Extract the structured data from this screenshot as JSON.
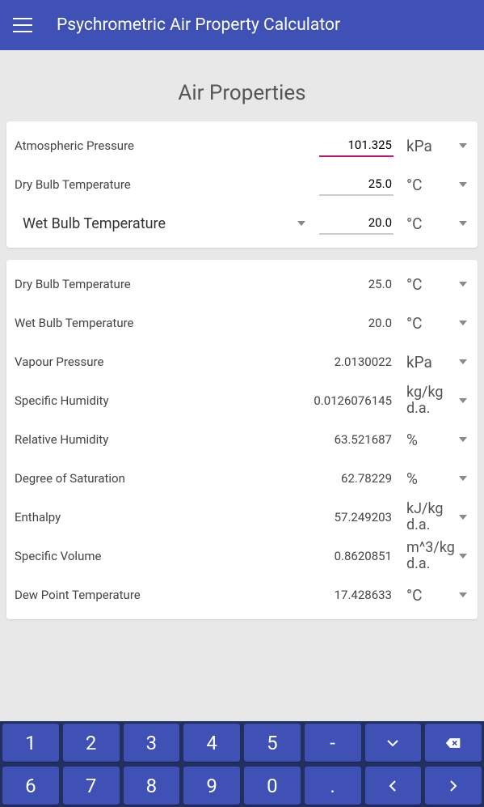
{
  "header": {
    "title": "Psychrometric Air Property Calculator"
  },
  "section_title": "Air Properties",
  "inputs": {
    "pressure": {
      "label": "Atmospheric Pressure",
      "value": "101.325",
      "unit": "kPa"
    },
    "dry_bulb": {
      "label": "Dry Bulb Temperature",
      "value": "25.0",
      "unit": "°C"
    },
    "wet_bulb": {
      "label": "Wet Bulb Temperature",
      "value": "20.0",
      "unit": "°C"
    }
  },
  "results": [
    {
      "label": "Dry Bulb Temperature",
      "value": "25.0",
      "unit": "°C"
    },
    {
      "label": "Wet Bulb Temperature",
      "value": "20.0",
      "unit": "°C"
    },
    {
      "label": "Vapour Pressure",
      "value": "2.0130022",
      "unit": "kPa"
    },
    {
      "label": "Specific Humidity",
      "value": "0.0126076145",
      "unit": "kg/kg d.a."
    },
    {
      "label": "Relative Humidity",
      "value": "63.521687",
      "unit": "%"
    },
    {
      "label": "Degree of Saturation",
      "value": "62.78229",
      "unit": "%"
    },
    {
      "label": "Enthalpy",
      "value": "57.249203",
      "unit": "kJ/kg d.a."
    },
    {
      "label": "Specific Volume",
      "value": "0.8620851",
      "unit": "m^3/kg d.a."
    },
    {
      "label": "Dew Point Temperature",
      "value": "17.428633",
      "unit": "°C"
    }
  ],
  "keypad": {
    "row1": [
      "1",
      "2",
      "3",
      "4",
      "5",
      "-"
    ],
    "row2": [
      "6",
      "7",
      "8",
      "9",
      "0",
      "."
    ]
  }
}
